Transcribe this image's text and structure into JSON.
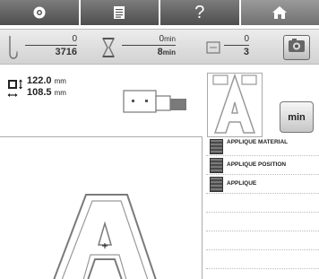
{
  "tabs": [
    {
      "icon": "gear-icon"
    },
    {
      "icon": "document-icon"
    },
    {
      "label": "?",
      "icon": "help-icon"
    },
    {
      "icon": "home-icon"
    }
  ],
  "counters": {
    "stitch_current": "0",
    "stitch_total": "3716",
    "time_current": "0",
    "time_total": "8",
    "time_unit": "min",
    "color_current": "0",
    "color_total": "3"
  },
  "dimensions": {
    "height_value": "122.0",
    "width_value": "108.5",
    "unit": "mm"
  },
  "preview": {
    "letter": "A"
  },
  "min_button_label": "min",
  "embroidery": {
    "letter": "A"
  },
  "color_list": [
    {
      "label": "APPLIQUE MATERIAL",
      "color": "#5a5a5a"
    },
    {
      "label": "APPLIQUE POSITION",
      "color": "#5a5a5a"
    },
    {
      "label": "APPLIQUE",
      "color": "#5a5a5a"
    }
  ],
  "colors": {
    "tab_bar": "#5a5a5a",
    "counter_bar": "#dcdcdc",
    "outline": "#8c8c8c"
  }
}
